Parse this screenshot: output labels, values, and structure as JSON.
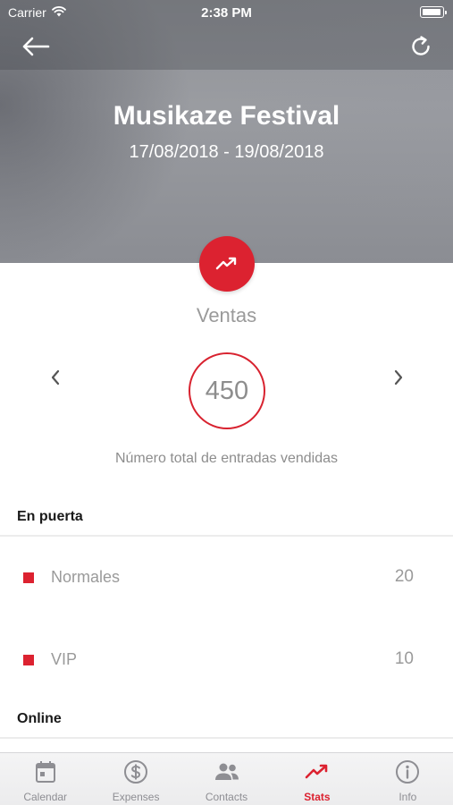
{
  "status_bar": {
    "carrier": "Carrier",
    "time": "2:38 PM"
  },
  "event": {
    "title": "Musikaze Festival",
    "dates": "17/08/2018 - 19/08/2018"
  },
  "stats": {
    "section_label": "Ventas",
    "total_value": "450",
    "total_caption": "Número total de entradas vendidas"
  },
  "groups": [
    {
      "title": "En puerta",
      "rows": [
        {
          "label": "Normales",
          "value": "20"
        },
        {
          "label": "VIP",
          "value": "10"
        }
      ]
    },
    {
      "title": "Online"
    }
  ],
  "tabs": [
    {
      "label": "Calendar",
      "icon": "calendar-icon",
      "active": false
    },
    {
      "label": "Expenses",
      "icon": "dollar-circle-icon",
      "active": false
    },
    {
      "label": "Contacts",
      "icon": "people-icon",
      "active": false
    },
    {
      "label": "Stats",
      "icon": "trending-up-icon",
      "active": true
    },
    {
      "label": "Info",
      "icon": "info-icon",
      "active": false
    }
  ],
  "colors": {
    "accent": "#dc2230",
    "muted_text": "#9a9a9a",
    "tab_inactive": "#8e8e93"
  }
}
